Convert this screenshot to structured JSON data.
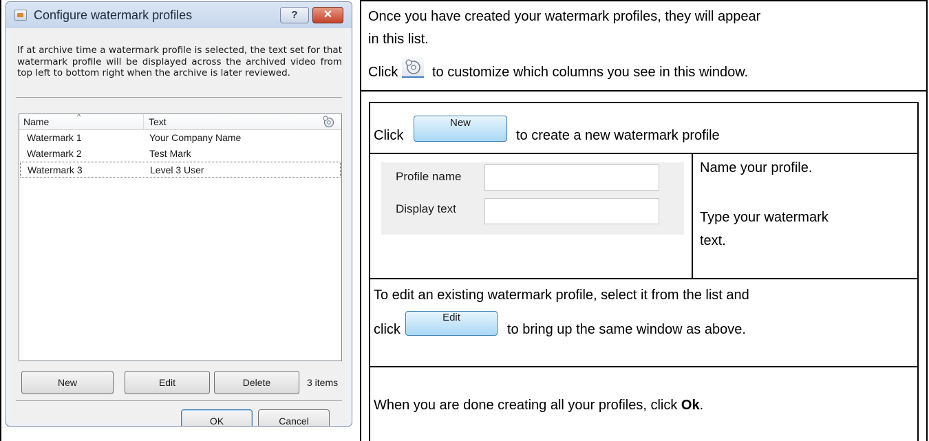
{
  "dialog": {
    "title": "Configure watermark profiles",
    "help_label": "?",
    "close_label": "✕",
    "description": "If at archive time a watermark profile is selected, the text set for that watermark profile will be displayed across the archived video from top left to bottom right when the archive is later reviewed.",
    "columns": [
      "Name",
      "Text"
    ],
    "rows": [
      {
        "name": "Watermark 1",
        "text": "Your Company Name"
      },
      {
        "name": "Watermark 2",
        "text": "Test Mark"
      },
      {
        "name": "Watermark 3",
        "text": "Level 3 User"
      }
    ],
    "buttons": {
      "new": "New",
      "edit": "Edit",
      "delete": "Delete",
      "ok": "OK",
      "cancel": "Cancel"
    },
    "item_count": "3 items"
  },
  "instructions": {
    "list_line1": "Once you have created your watermark profiles, they will appear",
    "list_line2": "in this list.",
    "customize_prefix": "Click",
    "customize_suffix": "to customize which columns you see in this window.",
    "new_prefix": "Click",
    "new_button": "New",
    "new_suffix": "to create a new watermark profile",
    "form": {
      "profile_name_label": "Profile name",
      "display_text_label": "Display text",
      "profile_name_value": "",
      "display_text_value": ""
    },
    "name_profile": "Name your profile.",
    "type_text_line1": "Type your watermark",
    "type_text_line2": "text.",
    "edit_line1": "To edit an existing watermark profile, select it from the list and",
    "edit_prefix": "click",
    "edit_button": "Edit",
    "edit_suffix": "to bring up the same window as above.",
    "done_prefix": "When you are done creating all your profiles, click",
    "done_bold": "Ok",
    "done_suffix": "."
  }
}
